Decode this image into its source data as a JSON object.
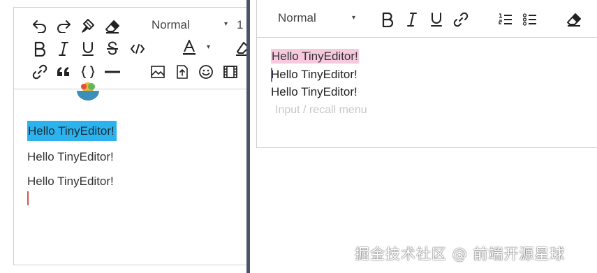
{
  "left_editor": {
    "toolbar": {
      "header_select": {
        "value": "Normal",
        "caret": "▾"
      },
      "size_select_partial": "1",
      "color_caret": "▾",
      "color_letter": "A"
    },
    "content": {
      "paragraphs": [
        "Hello TinyEditor!",
        "Hello TinyEditor!",
        "Hello TinyEditor!"
      ]
    }
  },
  "right_editor": {
    "toolbar": {
      "header_select": {
        "value": "Normal",
        "caret": "▾"
      }
    },
    "content": {
      "paragraphs": [
        "Hello TinyEditor!",
        "Hello TinyEditor!",
        "Hello TinyEditor!"
      ],
      "placeholder": "Input / recall menu"
    }
  },
  "watermark": "掘金技术社区 @ 前端开源星球",
  "colors": {
    "selection_blue": "#2cb3ee",
    "selection_pink": "#f6c9de",
    "divider": "#475569",
    "caret_red": "#d9534f",
    "caret_purple": "#7e57c2"
  }
}
